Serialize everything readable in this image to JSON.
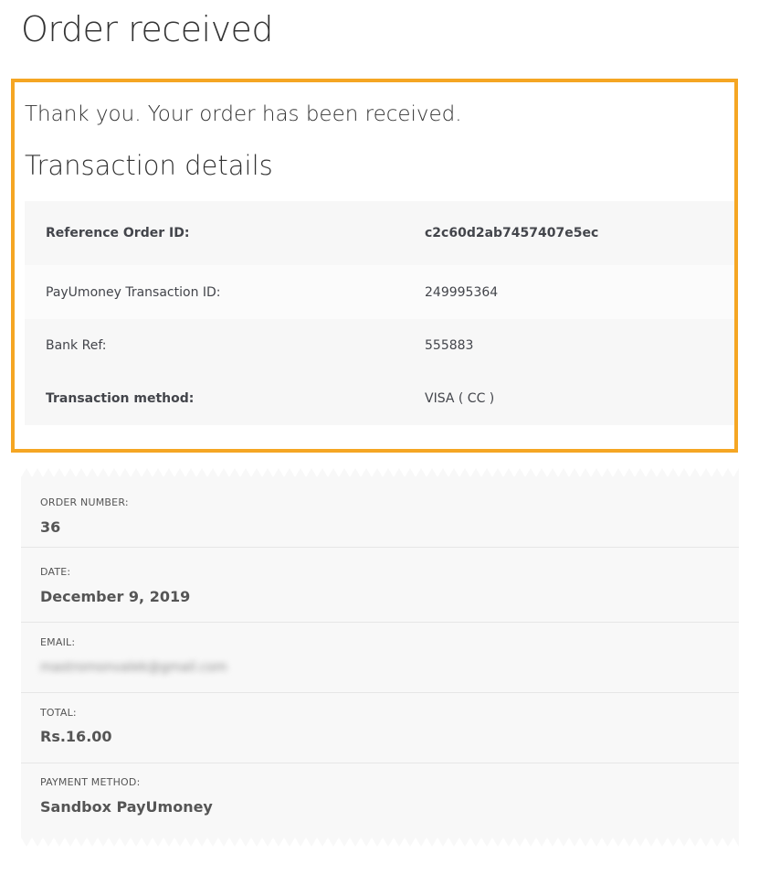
{
  "page": {
    "title": "Order received"
  },
  "notice": {
    "thank_you": "Thank you. Your order has been received.",
    "transaction_heading": "Transaction details"
  },
  "transaction_details": [
    {
      "label": "Reference Order ID:",
      "value": "c2c60d2ab7457407e5ec",
      "bold": true
    },
    {
      "label": "PayUmoney Transaction ID:",
      "value": "249995364",
      "bold": false
    },
    {
      "label": "Bank Ref:",
      "value": "555883",
      "bold": false
    },
    {
      "label": "Transaction method:",
      "value": "VISA ( CC )",
      "bold": "label"
    }
  ],
  "order_overview": {
    "order_number": {
      "label": "ORDER NUMBER:",
      "value": "36"
    },
    "date": {
      "label": "DATE:",
      "value": "December 9, 2019"
    },
    "email": {
      "label": "EMAIL:",
      "value": "mastromonvalek@gmail.com"
    },
    "total": {
      "label": "TOTAL:",
      "value": "Rs.16.00"
    },
    "payment_method": {
      "label": "PAYMENT METHOD:",
      "value": "Sandbox PayUmoney"
    }
  },
  "colors": {
    "highlight": "#f5a623",
    "panel": "#f7f7f7",
    "text": "#43454b"
  }
}
